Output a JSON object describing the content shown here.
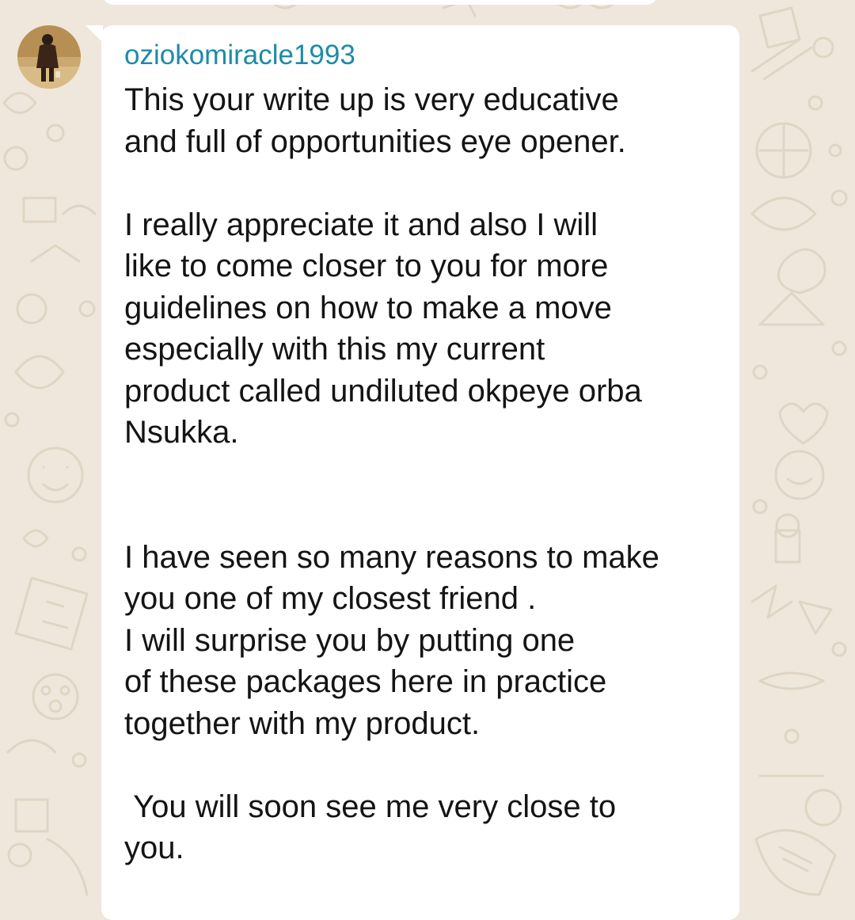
{
  "chat": {
    "sender": "oziokomiracle1993",
    "avatar_icon": "user-photo-avatar",
    "message": "This your write up is very educative\nand full of opportunities eye opener.\n\nI really appreciate it and also I will\nlike to come closer to you for more\nguidelines on how to make a move\nespecially with this my current\nproduct called undiluted okpeye orba\nNsukka.\n\n\nI have seen so many reasons to make\nyou one of my closest friend .\nI will surprise you by putting one\nof these packages here in practice\ntogether with my product.\n\n You will soon see me very close to\nyou."
  },
  "colors": {
    "background": "#efe7dc",
    "doodle": "#e0d5c4",
    "bubble": "#ffffff",
    "sender_name": "#1d8ba9",
    "message_text": "#141414"
  }
}
